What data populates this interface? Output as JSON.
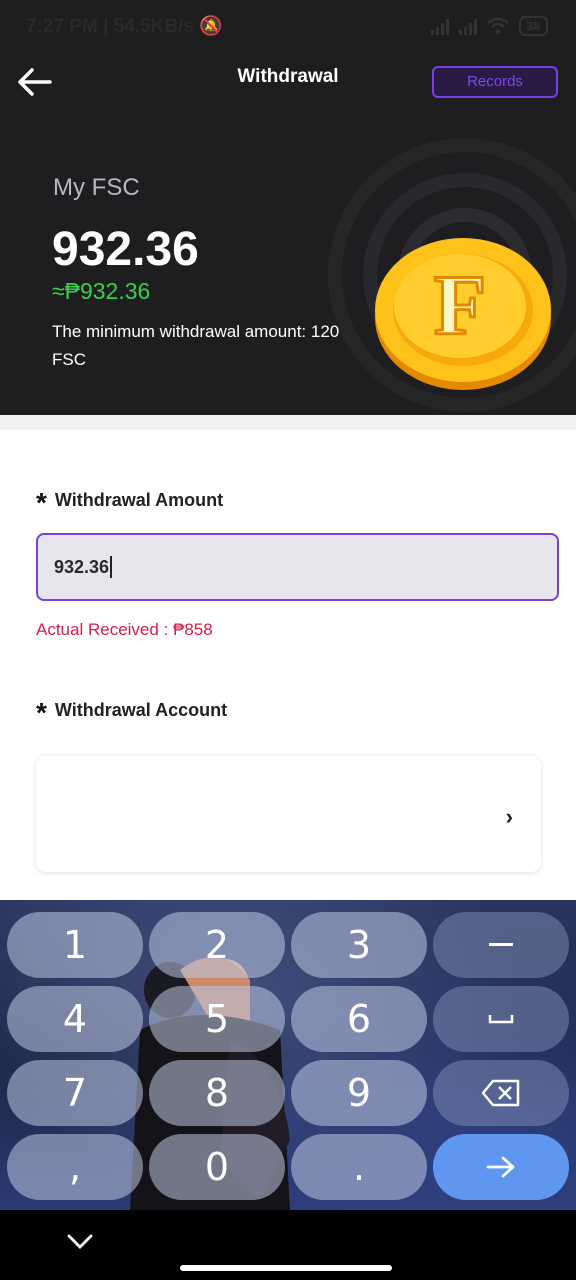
{
  "status_bar": {
    "time": "7:27 PM",
    "speed": "54.5KB/s",
    "battery": "38"
  },
  "header": {
    "title": "Withdrawal",
    "records_label": "Records"
  },
  "balance": {
    "label": "My FSC",
    "amount": "932.36",
    "peso_equivalent": "≈₱932.36",
    "minimum_note": "The minimum withdrawal amount: 120 FSC"
  },
  "form": {
    "amount_label": "Withdrawal Amount",
    "amount_value": "932.36",
    "actual_received": "Actual Received : ₱858",
    "account_label": "Withdrawal Account",
    "required_marker": "*"
  },
  "keyboard": {
    "keys": [
      "1",
      "2",
      "3",
      "4",
      "5",
      "6",
      "7",
      "8",
      "9",
      ",",
      "0",
      "."
    ],
    "icons": [
      "minus-icon",
      "space-icon",
      "backspace-icon",
      "enter-arrow-icon"
    ]
  },
  "colors": {
    "accent_purple": "#7a3fd9",
    "peso_green": "#35d34a",
    "warning_red": "#d2224a",
    "enter_blue": "#5f97f0"
  }
}
